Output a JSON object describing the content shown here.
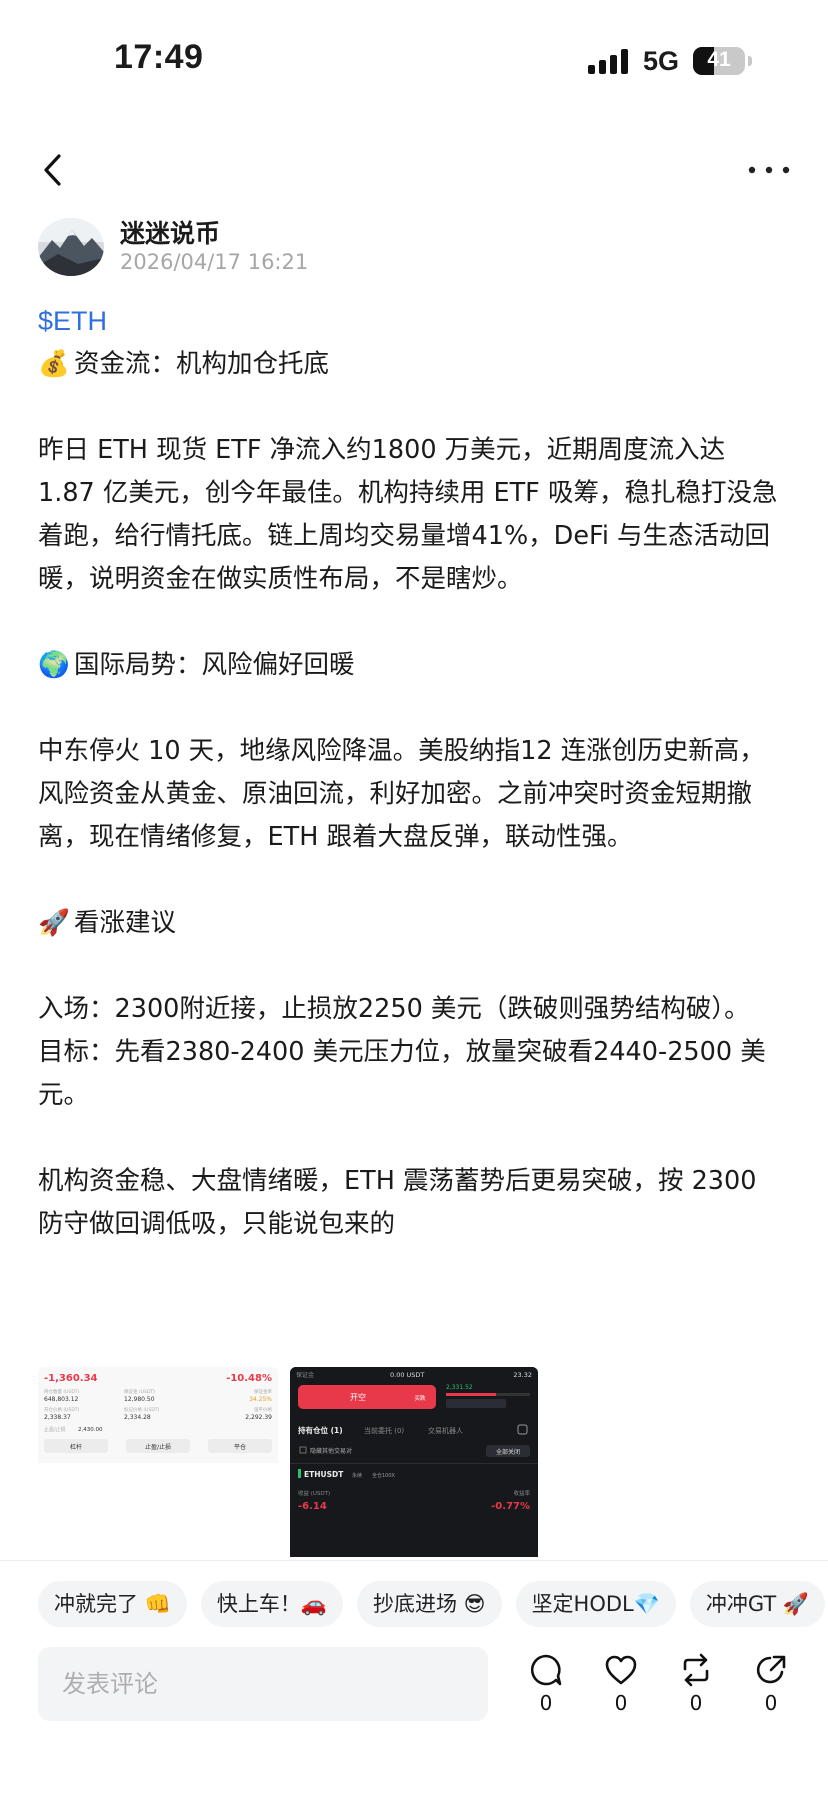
{
  "status_bar": {
    "time": "17:49",
    "network": "5G",
    "battery_level": "41",
    "battery_fraction": 0.41
  },
  "nav": {
    "back_icon": "chevron-left-icon",
    "more_icon": "more-dots-icon"
  },
  "author": {
    "name": "迷迷说币",
    "time": "2026/04/17 16:21"
  },
  "post": {
    "ticker": "$ETH",
    "section1_title": "资金流：机构加仓托底",
    "section1_body": "昨日 ETH 现货 ETF 净流入约1800 万美元，近期周度流入达 1.87 亿美元，创今年最佳。机构持续用 ETF 吸筹，稳扎稳打没急着跑，给行情托底。链上周均交易量增41%，DeFi 与生态活动回暖，说明资金在做实质性布局，不是瞎炒。",
    "section2_title": "国际局势：风险偏好回暖",
    "section2_body": "中东停火 10 天，地缘风险降温。美股纳指12 连涨创历史新高，风险资金从黄金、原油回流，利好加密。之前冲突时资金短期撤离，现在情绪修复，ETH 跟着大盘反弹，联动性强。",
    "section3_title": "看涨建议",
    "entry": "入场：2300附近接，止损放2250 美元（跌破则强势结构破）。",
    "target": "目标：先看2380-2400 美元压力位，放量突破看2440-2500 美元。",
    "conclusion": "机构资金稳、大盘情绪暖，ETH 震荡蓄势后更易突破，按 2300 防守做回调低吸，只能说包来的",
    "emoji": {
      "s1": "💰",
      "s2": "🌍",
      "s3": "🚀"
    }
  },
  "images": {
    "shot1": {
      "pnl": "-1,360.34",
      "pct": "-10.48%",
      "rows": [
        [
          "648,803.12",
          "12,980.50",
          "34.25%"
        ],
        [
          "2,338.37",
          "2,334.28",
          "2,292.39"
        ]
      ],
      "extra": "2,430.00",
      "buttons": [
        "杠杆",
        "止盈/止损",
        "平仓"
      ]
    },
    "shot2": {
      "top_left": "保证金",
      "top_mid": "0.00 USDT",
      "top_right": "23.32",
      "price": "2,331.52",
      "open_btn": "开空",
      "open_sub": "买跌",
      "tabs": [
        "持有仓位 (1)",
        "当前委托 (0)",
        "交易机器人"
      ],
      "hide_other": "隐藏其他交易对",
      "close_all": "全部关闭",
      "pair": "ETHUSDT",
      "pair_tag1": "永续",
      "pair_tag2": "全仓100X",
      "label_left": "收益 (USDT)",
      "label_right": "收益率",
      "pnl": "-6.14",
      "pct": "-0.77%"
    }
  },
  "quick_replies": [
    "冲就完了 👊",
    "快上车！🚗",
    "抄底进场 😎",
    "坚定HODL💎",
    "冲冲GT 🚀"
  ],
  "comment": {
    "placeholder": "发表评论"
  },
  "actions": {
    "comment_count": "0",
    "like_count": "0",
    "repost_count": "0",
    "share_count": "0"
  },
  "colors": {
    "accent_blue": "#2f6fe0",
    "danger_red": "#e8394a",
    "chip_bg": "#f3f4f6"
  }
}
